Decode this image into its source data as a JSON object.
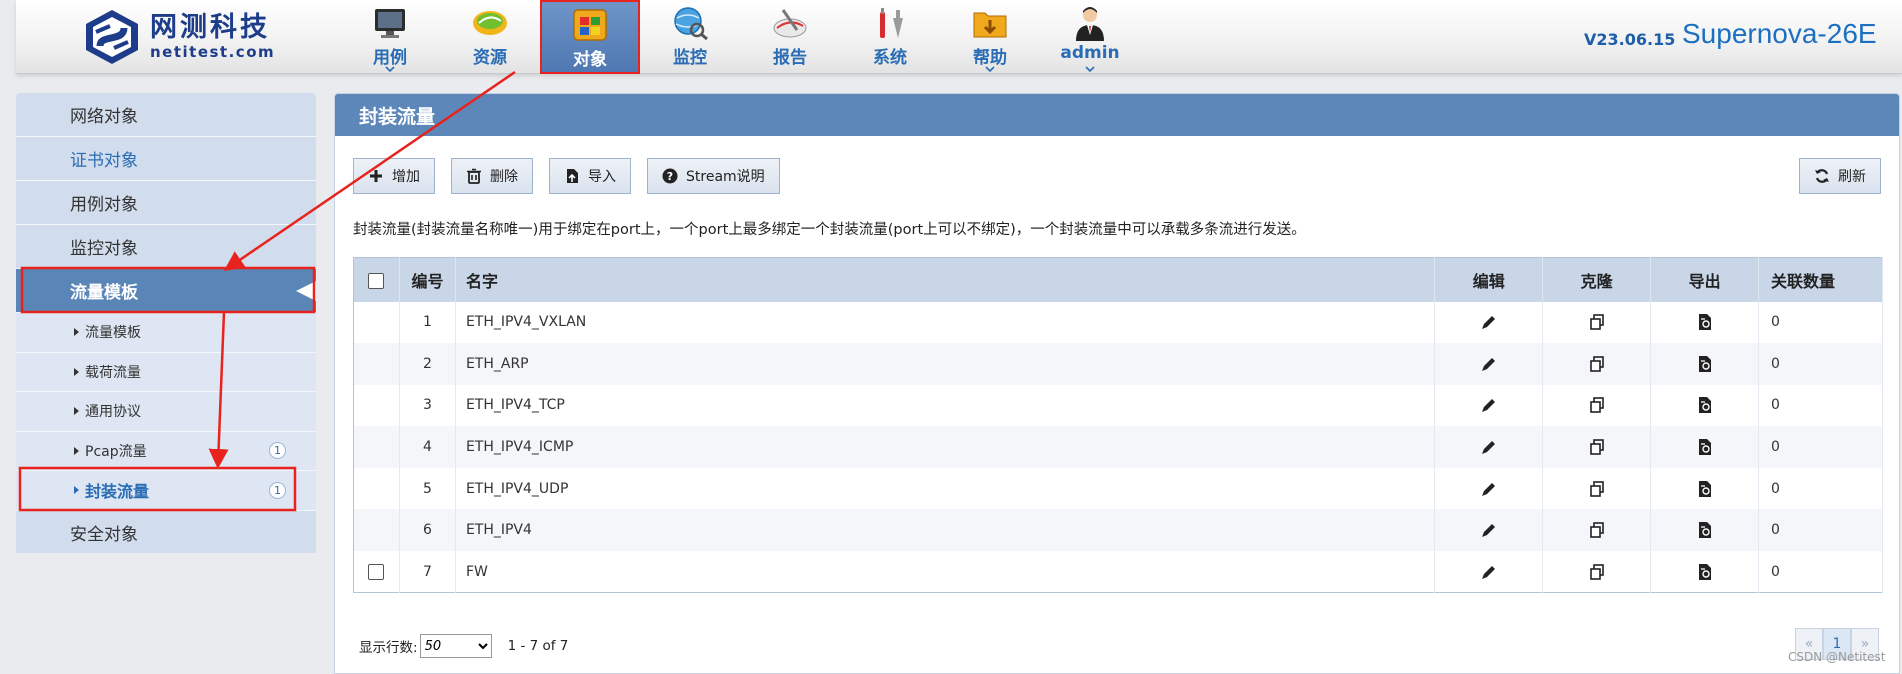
{
  "brand": {
    "name_cn": "网测科技",
    "name_en": "netitest.com"
  },
  "nav": [
    {
      "label": "用例",
      "icon": "monitor-icon",
      "dropdown": true
    },
    {
      "label": "资源",
      "icon": "resource-icon",
      "dropdown": false
    },
    {
      "label": "对象",
      "icon": "objects-icon",
      "dropdown": false,
      "active": true
    },
    {
      "label": "监控",
      "icon": "monitor-globe-icon",
      "dropdown": false
    },
    {
      "label": "报告",
      "icon": "report-icon",
      "dropdown": false
    },
    {
      "label": "系统",
      "icon": "tools-icon",
      "dropdown": false
    },
    {
      "label": "帮助",
      "icon": "folder-icon",
      "dropdown": true
    },
    {
      "label": "admin",
      "icon": "user-icon",
      "dropdown": true
    }
  ],
  "version": "V23.06.15",
  "product": "Supernova-26E",
  "sidebar": {
    "items": [
      {
        "label": "网络对象"
      },
      {
        "label": "证书对象"
      },
      {
        "label": "用例对象"
      },
      {
        "label": "监控对象"
      },
      {
        "label": "流量模板"
      }
    ],
    "subitems": [
      {
        "label": "流量模板",
        "badge": ""
      },
      {
        "label": "载荷流量",
        "badge": ""
      },
      {
        "label": "通用协议",
        "badge": ""
      },
      {
        "label": "Pcap流量",
        "badge": "1"
      },
      {
        "label": "封装流量",
        "badge": "1"
      }
    ],
    "footer_item": {
      "label": "安全对象"
    }
  },
  "panel": {
    "title": "封装流量",
    "buttons": {
      "add": "增加",
      "delete": "删除",
      "import": "导入",
      "stream": "Stream说明",
      "refresh": "刷新"
    },
    "description": "封装流量(封装流量名称唯一)用于绑定在port上，一个port上最多绑定一个封装流量(port上可以不绑定)，一个封装流量中可以承载多条流进行发送。",
    "table": {
      "headers": {
        "num": "编号",
        "name": "名字",
        "edit": "编辑",
        "clone": "克隆",
        "export": "导出",
        "count": "关联数量"
      },
      "rows": [
        {
          "num": "1",
          "name": "ETH_IPV4_VXLAN",
          "count": "0",
          "checkbox": false
        },
        {
          "num": "2",
          "name": "ETH_ARP",
          "count": "0",
          "checkbox": false
        },
        {
          "num": "3",
          "name": "ETH_IPV4_TCP",
          "count": "0",
          "checkbox": false
        },
        {
          "num": "4",
          "name": "ETH_IPV4_ICMP",
          "count": "0",
          "checkbox": false
        },
        {
          "num": "5",
          "name": "ETH_IPV4_UDP",
          "count": "0",
          "checkbox": false
        },
        {
          "num": "6",
          "name": "ETH_IPV4",
          "count": "0",
          "checkbox": false
        },
        {
          "num": "7",
          "name": "FW",
          "count": "0",
          "checkbox": true
        }
      ]
    },
    "pager": {
      "rows_label": "显示行数:",
      "rows_value": "50",
      "range": "1 - 7 of 7",
      "prev": "«",
      "page": "1",
      "next": "»"
    }
  },
  "watermark": "CSDN @Netitest",
  "colors": {
    "accent": "#5d87b8",
    "highlight": "#e8231e",
    "link": "#2a6db5"
  }
}
